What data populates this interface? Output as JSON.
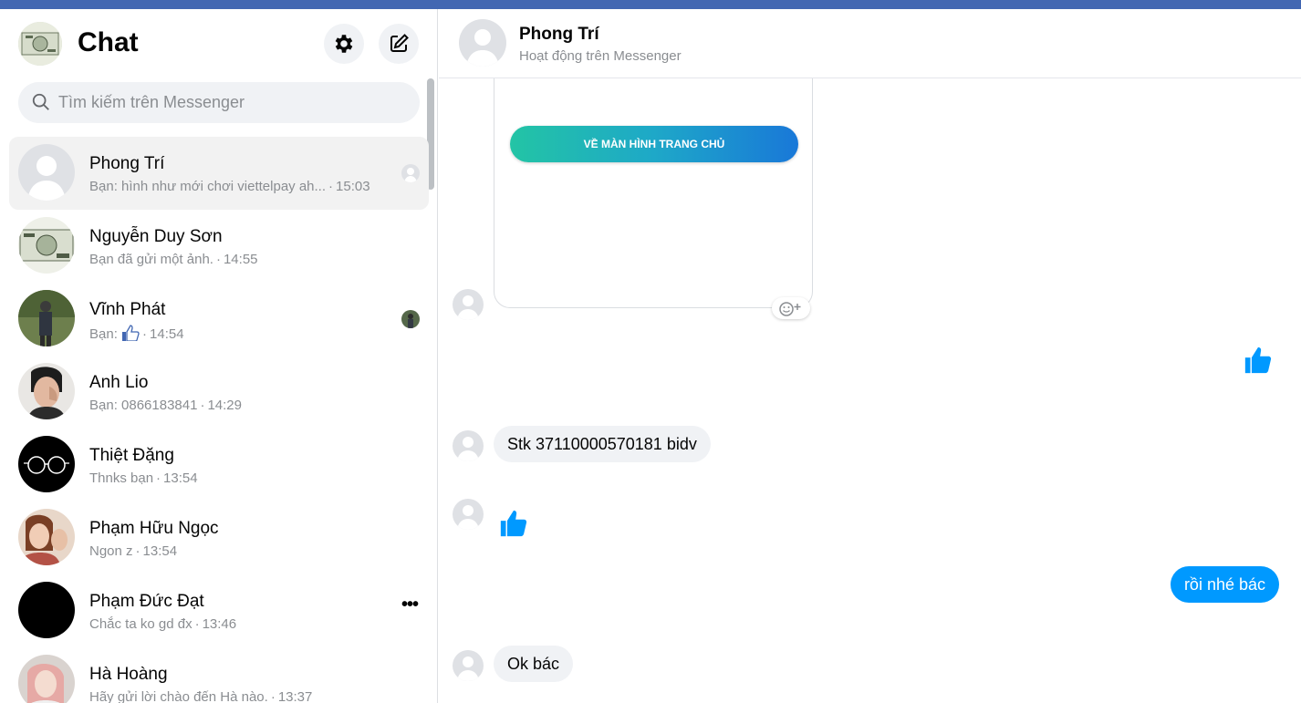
{
  "sidebar": {
    "title": "Chat",
    "settings_icon": "gear-icon",
    "compose_icon": "compose-icon",
    "search": {
      "placeholder": "Tìm kiếm trên Messenger",
      "value": ""
    },
    "conversations": [
      {
        "name": "Phong Trí",
        "preview": "Bạn: hình như mới chơi viettelpay ah...",
        "time": "15:03",
        "active": true,
        "indicator": "seen-avatar"
      },
      {
        "name": "Nguyễn Duy Sơn",
        "preview": "Bạn đã gửi một ảnh.",
        "time": "14:55",
        "active": false,
        "indicator": ""
      },
      {
        "name": "Vĩnh Phát",
        "preview": "Bạn:",
        "preview_icon": "thumbs-up-icon",
        "time": "14:54",
        "active": false,
        "indicator": "seen-avatar"
      },
      {
        "name": "Anh Lio",
        "preview": "Bạn: 0866183841",
        "time": "14:29",
        "active": false,
        "indicator": ""
      },
      {
        "name": "Thiệt Đặng",
        "preview": "Thnks bạn",
        "time": "13:54",
        "active": false,
        "indicator": ""
      },
      {
        "name": "Phạm Hữu Ngọc",
        "preview": "Ngon z",
        "time": "13:54",
        "active": false,
        "indicator": ""
      },
      {
        "name": "Phạm Đức Đạt",
        "preview": "Chắc ta ko gd đx",
        "time": "13:46",
        "active": false,
        "indicator": "more-icon"
      },
      {
        "name": "Hà Hoàng",
        "preview": "Hãy gửi lời chào đến Hà nào.",
        "time": "13:37",
        "active": false,
        "indicator": ""
      }
    ],
    "separator": "·"
  },
  "chat": {
    "contact_name": "Phong Trí",
    "status": "Hoạt động trên Messenger",
    "card_button_label": "VỀ MÀN HÌNH TRANG CHỦ",
    "react_icon": "emoji-add-icon",
    "messages": [
      {
        "from": "me",
        "type": "like",
        "icon": "thumbs-up-icon"
      },
      {
        "from": "them",
        "type": "text",
        "text": "Stk 37110000570181 bidv"
      },
      {
        "from": "them",
        "type": "like",
        "icon": "thumbs-up-icon"
      },
      {
        "from": "me",
        "type": "text",
        "text": "rồi nhé bác"
      },
      {
        "from": "them",
        "type": "text",
        "text": "Ok bác"
      }
    ]
  },
  "colors": {
    "accent": "#0099ff",
    "topbar": "#4267b2",
    "bubble_in": "#f0f2f5",
    "muted_text": "#8a8d91"
  }
}
